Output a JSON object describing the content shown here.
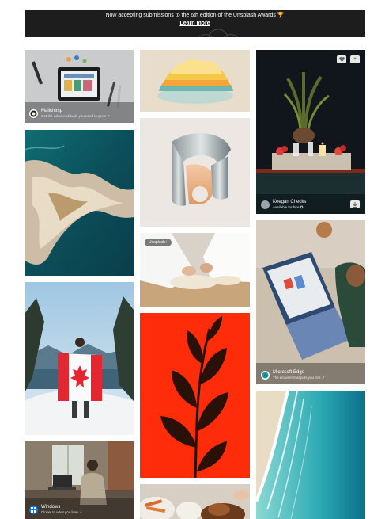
{
  "banner": {
    "message": "Now accepting submissions to the 6th edition of the Unsplash Awards 🏆",
    "link": "Learn more"
  },
  "tiles": {
    "mailchimp": {
      "name": "Mailchimp",
      "sub": "Get the advanced tools you need to grow ↗"
    },
    "keegan": {
      "name": "Keegan Checks",
      "sub": "Available for hire ✪"
    },
    "plus_badge": "Unsplash+",
    "edge": {
      "name": "Microsoft Edge",
      "sub": "The browser that puts you first ↗"
    },
    "windows": {
      "name": "Windows",
      "sub": "Closer to what you love ↗"
    }
  },
  "icons": {
    "like": "heart-icon",
    "add": "plus-icon",
    "download": "download-arrow-icon"
  },
  "colors": {
    "banner_bg": "#1d1d1d",
    "leaf_bg": "#ff2c0a",
    "leaf": "#2a1108"
  }
}
